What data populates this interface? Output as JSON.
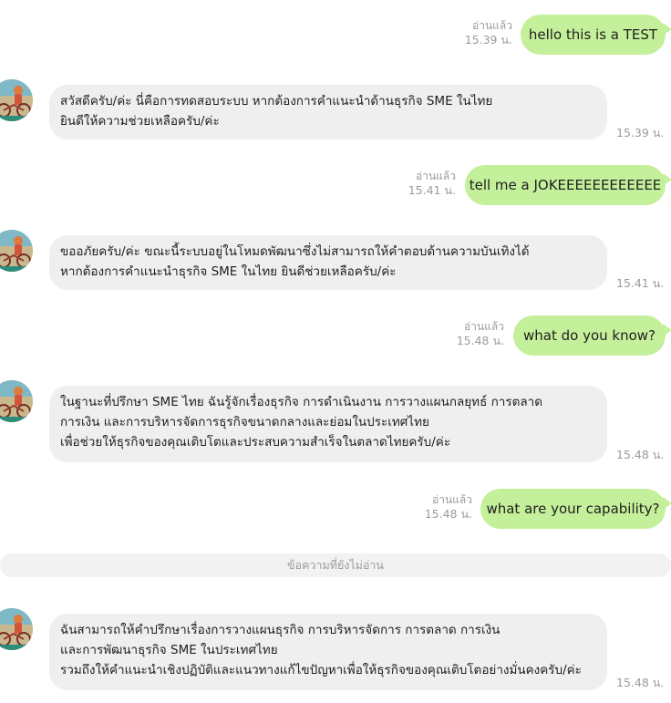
{
  "messages": [
    {
      "side": "out",
      "text": "hello this is a TEST",
      "read": "อ่านแล้ว",
      "time": "15.39 น."
    },
    {
      "side": "in",
      "lines": [
        "สวัสดีครับ/ค่ะ นี่คือการทดสอบระบบ หากต้องการคำแนะนำด้านธุรกิจ SME ในไทย",
        "ยินดีให้ความช่วยเหลือครับ/ค่ะ"
      ],
      "time": "15.39 น."
    },
    {
      "side": "out",
      "text": "tell me a JOKEEEEEEEEEEEE",
      "read": "อ่านแล้ว",
      "time": "15.41 น."
    },
    {
      "side": "in",
      "lines": [
        "ขออภัยครับ/ค่ะ ขณะนี้ระบบอยู่ในโหมดพัฒนาซึ่งไม่สามารถให้คำตอบด้านความบันเทิงได้",
        "หากต้องการคำแนะนำธุรกิจ SME ในไทย ยินดีช่วยเหลือครับ/ค่ะ"
      ],
      "time": "15.41 น."
    },
    {
      "side": "out",
      "text": "what do you know?",
      "read": "อ่านแล้ว",
      "time": "15.48 น."
    },
    {
      "side": "in",
      "lines": [
        "ในฐานะที่ปรึกษา SME ไทย ฉันรู้จักเรื่องธุรกิจ การดำเนินงาน การวางแผนกลยุทธ์ การตลาด",
        "การเงิน และการบริหารจัดการธุรกิจขนาดกลางและย่อมในประเทศไทย",
        "เพื่อช่วยให้ธุรกิจของคุณเติบโตและประสบความสำเร็จในตลาดไทยครับ/ค่ะ"
      ],
      "time": "15.48 น."
    },
    {
      "side": "out",
      "text": "what are your capability?",
      "read": "อ่านแล้ว",
      "time": "15.48 น."
    },
    {
      "side": "in",
      "lines": [
        "ฉันสามารถให้คำปรึกษาเรื่องการวางแผนธุรกิจ การบริหารจัดการ การตลาด การเงิน",
        "และการพัฒนาธุรกิจ SME ในประเทศไทย",
        "รวมถึงให้คำแนะนำเชิงปฏิบัติและแนวทางแก้ไขปัญหาเพื่อให้ธุรกิจของคุณเติบโตอย่างมั่นคงครับ/ค่ะ"
      ],
      "time": "15.48 น."
    }
  ],
  "divider_text": "ข้อความที่ยังไม่อ่าน",
  "colors": {
    "outgoing_bubble": "#c5f09b",
    "incoming_bubble": "#efefef",
    "meta_text": "#9b9b9b"
  },
  "icons": {
    "avatar": "bot-avatar-cyclist-illustration"
  }
}
